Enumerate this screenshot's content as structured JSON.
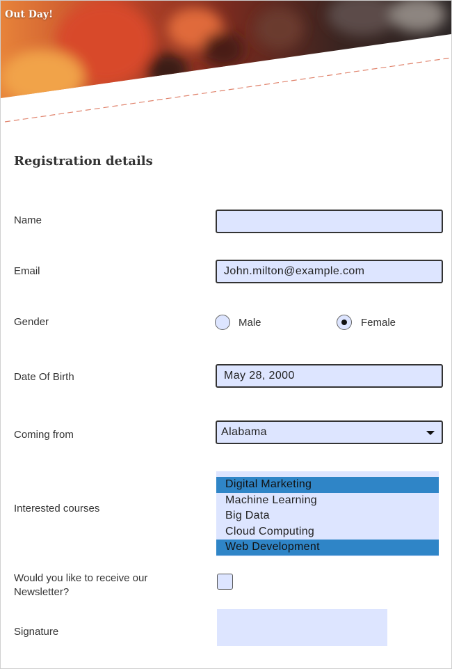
{
  "header": {
    "title": "Out Day!"
  },
  "form": {
    "section_title": "Registration details",
    "name": {
      "label": "Name",
      "value": ""
    },
    "email": {
      "label": "Email",
      "value": "John.milton@example.com"
    },
    "gender": {
      "label": "Gender",
      "options": [
        {
          "label": "Male",
          "checked": false
        },
        {
          "label": "Female",
          "checked": true
        }
      ]
    },
    "dob": {
      "label": "Date Of Birth",
      "value": "May 28, 2000"
    },
    "coming_from": {
      "label": "Coming from",
      "value": "Alabama"
    },
    "courses": {
      "label": "Interested courses",
      "options": [
        {
          "label": "Digital Marketing",
          "selected": true
        },
        {
          "label": "Machine Learning",
          "selected": false
        },
        {
          "label": "Big Data",
          "selected": false
        },
        {
          "label": "Cloud Computing",
          "selected": false
        },
        {
          "label": "Web Development",
          "selected": true
        }
      ]
    },
    "newsletter": {
      "label": "Would you like to receive our Newsletter?",
      "checked": false
    },
    "signature": {
      "label": "Signature"
    }
  },
  "colors": {
    "field_bg": "#dde5ff",
    "selected_option": "#2f85c7",
    "dashed_line": "#e0836c"
  }
}
